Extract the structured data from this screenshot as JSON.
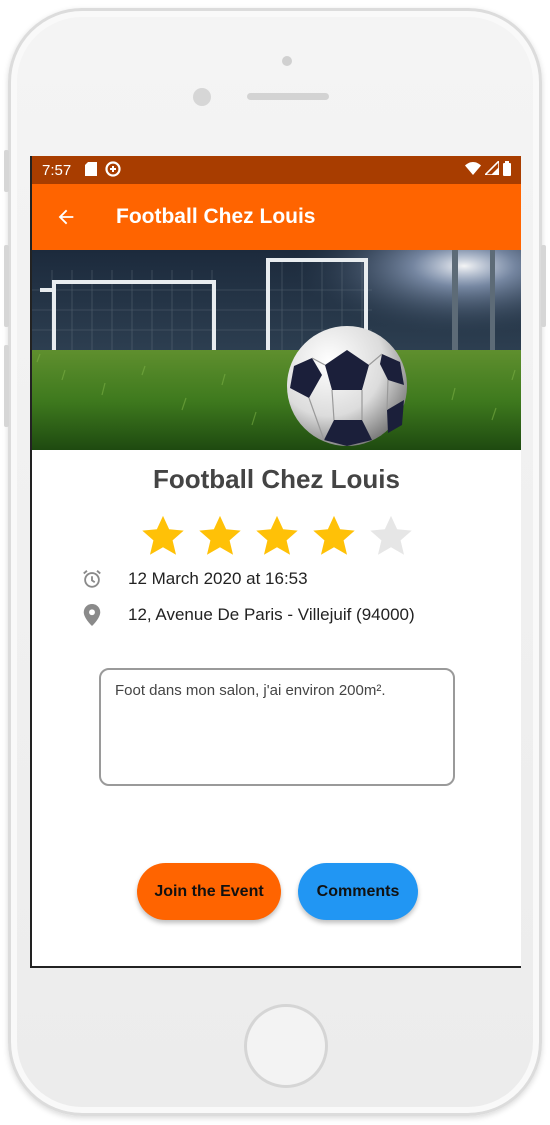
{
  "status_bar": {
    "time": "7:57"
  },
  "app_bar": {
    "title": "Football Chez Louis",
    "back_icon": "arrow-left-icon"
  },
  "event": {
    "title": "Football Chez Louis",
    "rating": 4,
    "rating_max": 5,
    "date_text": "12 March 2020 at 16:53",
    "address_text": "12, Avenue De Paris -  Villejuif (94000)",
    "description": "Foot dans mon salon, j'ai environ 200m²."
  },
  "actions": {
    "join_label": "Join the Event",
    "comments_label": "Comments"
  },
  "colors": {
    "status_bar": "#a83d00",
    "primary": "#ff6400",
    "secondary": "#2196f3",
    "star_filled": "#ffc107",
    "star_empty": "#e6e6e6"
  }
}
